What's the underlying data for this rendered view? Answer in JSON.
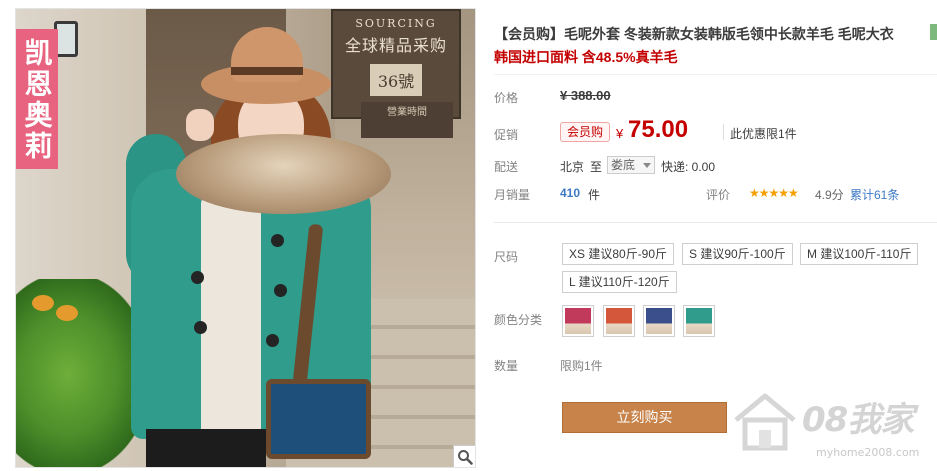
{
  "product_image": {
    "brand_tag": "凯恩奥莉",
    "sign_main_small": "全球精品采购",
    "sign_main_large": "SOURCING",
    "sign_number": "36號",
    "sign_sub": "營業時間",
    "zoom_icon": "magnifier-icon"
  },
  "product": {
    "title": "【会员购】毛呢外套 冬装新款女装韩版毛领中长款羊毛 毛呢大衣",
    "subtitle": "韩国进口面料 含48.5%真羊毛"
  },
  "price": {
    "label": "价格",
    "original": "¥ 388.00"
  },
  "promo": {
    "label": "促销",
    "badge": "会员购",
    "currency": "¥",
    "value": "75.00",
    "limit_note": "此优惠限1件"
  },
  "shipping": {
    "label": "配送",
    "from": "北京",
    "to_word": "至",
    "destination": "娄底",
    "express": "快递: 0.00"
  },
  "sales": {
    "label": "月销量",
    "count": "410",
    "unit": "件",
    "rating_label": "评价",
    "stars": "★★★★★",
    "score": "4.9分",
    "reviews": "累计61条"
  },
  "size": {
    "label": "尺码",
    "options": [
      "XS 建议80斤-90斤",
      "S 建议90斤-100斤",
      "M 建议100斤-110斤",
      "L 建议110斤-120斤"
    ]
  },
  "color": {
    "label": "颜色分类",
    "swatches": [
      "#c23a5b",
      "#d4563b",
      "#3b4f8c",
      "#2f9c8c"
    ]
  },
  "quantity": {
    "label": "数量",
    "value": "限购1件"
  },
  "buy_button": "立刻购买",
  "watermark": {
    "main": "08我家",
    "url": "myhome2008.com"
  }
}
